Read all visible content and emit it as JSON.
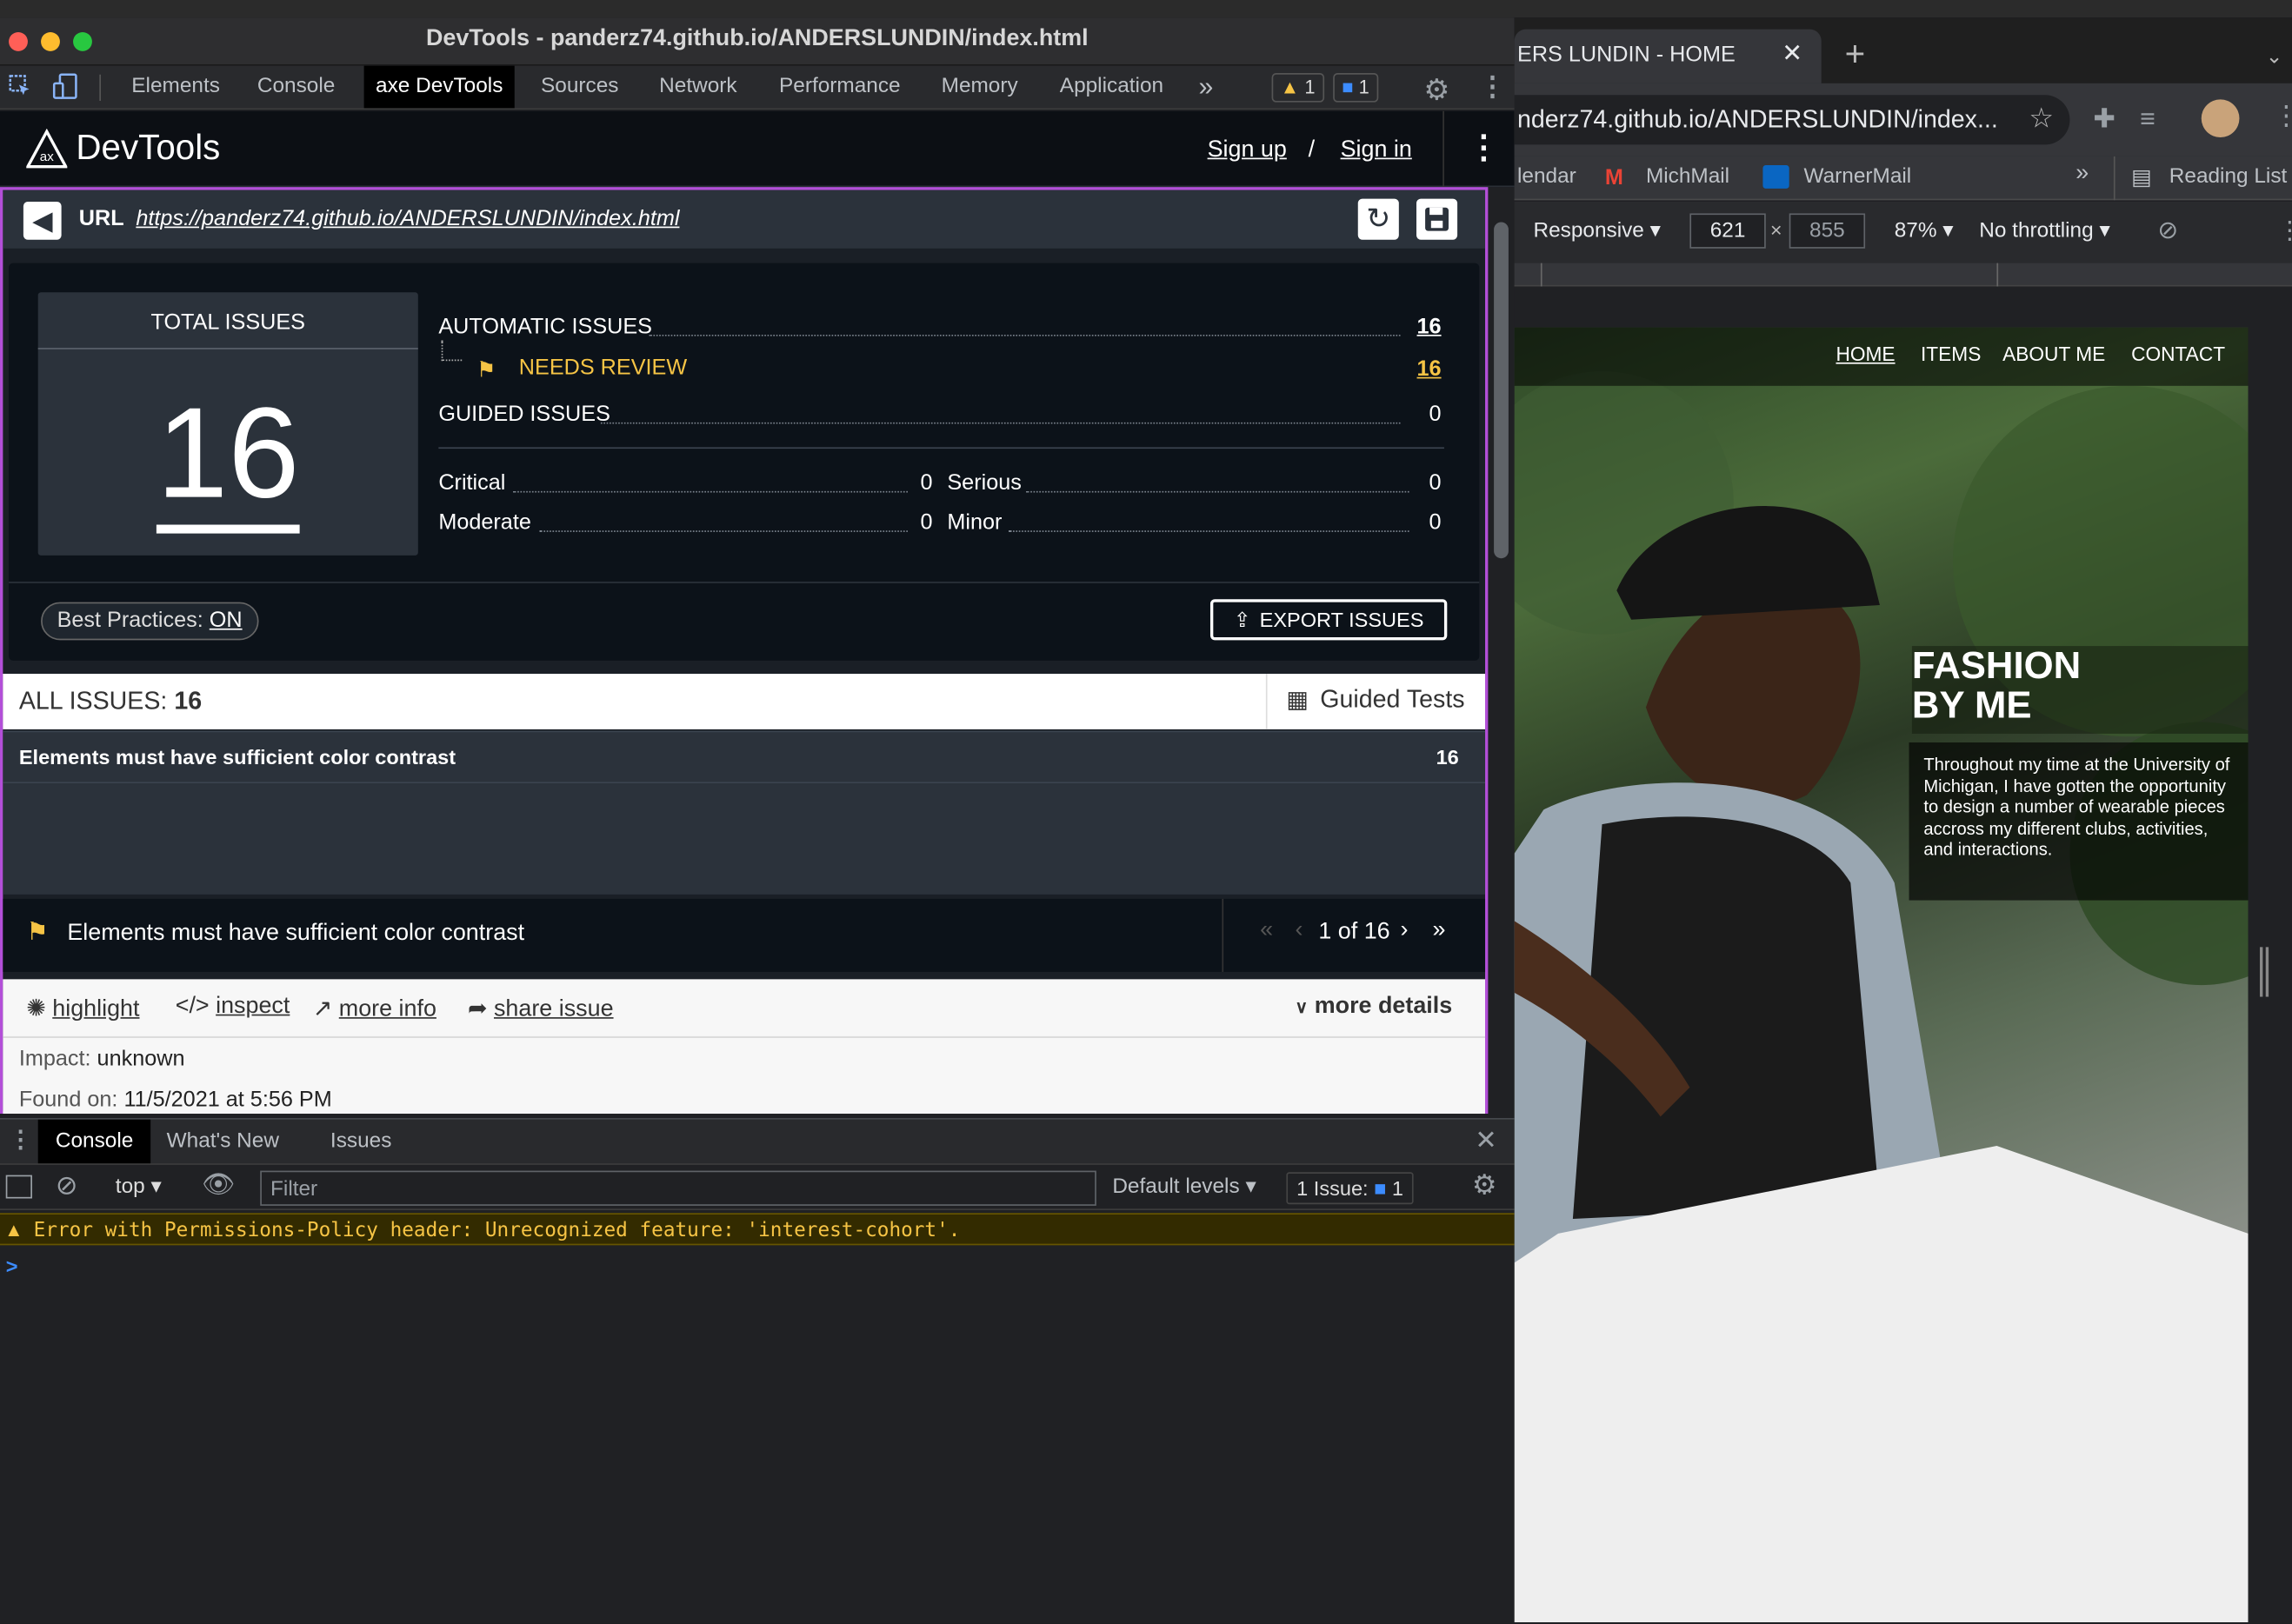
{
  "window": {
    "title": "DevTools - panderz74.github.io/ANDERSLUNDIN/index.html"
  },
  "devtools": {
    "tabs": [
      "Elements",
      "Console",
      "axe DevTools",
      "Sources",
      "Network",
      "Performance",
      "Memory",
      "Application"
    ],
    "more_tabs": "»",
    "warn_count": "1",
    "msg_count": "1"
  },
  "axe": {
    "brand": "DevTools",
    "sign_up": "Sign up",
    "sep": "/",
    "sign_in": "Sign in",
    "url_label": "URL",
    "url": "https://panderz74.github.io/ANDERSLUNDIN/index.html",
    "total_label": "TOTAL ISSUES",
    "total": "16",
    "automatic_label": "AUTOMATIC ISSUES",
    "automatic": "16",
    "needs_review_label": "NEEDS REVIEW",
    "needs_review": "16",
    "guided_label": "GUIDED ISSUES",
    "guided": "0",
    "critical_label": "Critical",
    "critical": "0",
    "serious_label": "Serious",
    "serious": "0",
    "moderate_label": "Moderate",
    "moderate": "0",
    "minor_label": "Minor",
    "minor": "0",
    "best_practices_label": "Best Practices:",
    "best_practices_value": "ON",
    "export_label": "EXPORT ISSUES",
    "all_issues_label": "ALL ISSUES:",
    "all_issues_count": "16",
    "guided_tests_label": "Guided Tests",
    "issue_row_title": "Elements must have sufficient color contrast",
    "issue_row_count": "16",
    "detail_title": "Elements must have sufficient color contrast",
    "pager": "1 of 16",
    "actions": {
      "highlight": "highlight",
      "inspect": "inspect",
      "more_info": "more info",
      "share": "share issue",
      "more_details": "more details"
    },
    "impact_label": "Impact:",
    "impact_value": "unknown",
    "found_label": "Found on:",
    "found_value": "11/5/2021 at 5:56 PM"
  },
  "console": {
    "tabs": [
      "Console",
      "What's New",
      "Issues"
    ],
    "context": "top",
    "filter_placeholder": "Filter",
    "levels": "Default levels",
    "issues_label": "1 Issue:",
    "issues_count": "1",
    "error": "Error with Permissions-Policy header: Unrecognized feature: 'interest-cohort'.",
    "prompt": ">"
  },
  "browser": {
    "tab_title": "ERS LUNDIN - HOME",
    "address": "nderz74.github.io/ANDERSLUNDIN/index...",
    "bookmarks": [
      "lendar",
      "MichMail",
      "WarnerMail"
    ],
    "reading_list": "Reading List",
    "device": "Responsive",
    "width": "621",
    "height": "855",
    "zoom": "87%",
    "throttle": "No throttling"
  },
  "site": {
    "nav": [
      "HOME",
      "ITEMS",
      "ABOUT ME",
      "CONTACT"
    ],
    "hero_title_1": "FASHION",
    "hero_title_2": "BY ME",
    "hero_text": "Throughout my time at the University of Michigan, I have gotten the opportunity to design a number of wearable pieces accross my different clubs, activities, and interactions."
  },
  "colors": {
    "accent": "#b34fd8",
    "warning": "#f6c445",
    "panel": "#0c1219"
  }
}
